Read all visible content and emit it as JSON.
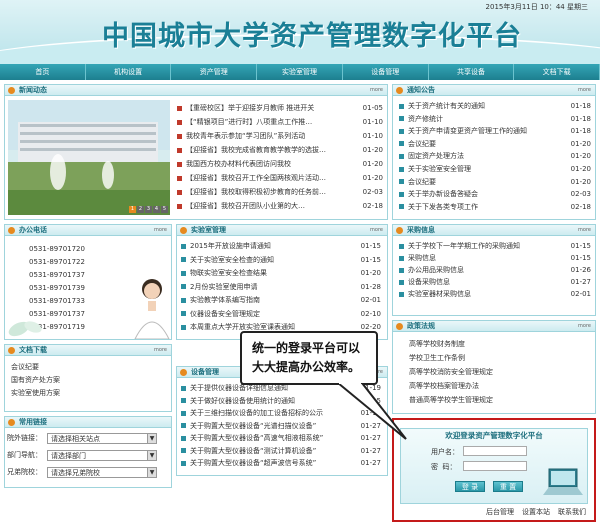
{
  "header": {
    "title": "中国城市大学资产管理数字化平台",
    "date": "2015年3月11日 10：44 星期三"
  },
  "nav": [
    "首页",
    "机构设置",
    "资产管理",
    "实验室管理",
    "设备管理",
    "共享设备",
    "文档下载"
  ],
  "news": {
    "title": "新闻动态",
    "more": "more",
    "items": [
      {
        "text": "【重磅校区】举于迎接岁月教师 推进开关",
        "date": "01-05"
      },
      {
        "text": "【“精银项目”进行时】八项重点工作推…",
        "date": "01-10"
      },
      {
        "text": "我校青年表示参加“学习团队”系列活动",
        "date": "01-10"
      },
      {
        "text": "【迎接省】我校完成省教育教学教学的选拔…",
        "date": "01-20"
      },
      {
        "text": "我国西方校办材料代表团访问我校",
        "date": "01-20"
      },
      {
        "text": "【迎接省】我校召开工作全国两核观片活动…",
        "date": "01-20"
      },
      {
        "text": "【迎接省】我校取得积极初步教育的任务前…",
        "date": "02-03"
      },
      {
        "text": "【迎接省】我校召开团队小业第的大…",
        "date": "02-18"
      }
    ],
    "slider": [
      "1",
      "2",
      "3",
      "4",
      "5"
    ]
  },
  "notice": {
    "title": "通知公告",
    "more": "more",
    "items": [
      {
        "text": "关于资产统计有关的通知",
        "date": "01-18"
      },
      {
        "text": "资产修统计",
        "date": "01-18"
      },
      {
        "text": "关于资产申请变更资产管理工作的通知",
        "date": "01-18"
      },
      {
        "text": "会议纪要",
        "date": "01-20"
      },
      {
        "text": "固定资产处理方法",
        "date": "01-20"
      },
      {
        "text": "关于实验室安全管理",
        "date": "01-20"
      },
      {
        "text": "会议纪要",
        "date": "01-20"
      },
      {
        "text": "关于举办新设备答疑会",
        "date": "02-03"
      },
      {
        "text": "关于下发各类专项工作",
        "date": "02-18"
      }
    ]
  },
  "office": {
    "title": "办公电话",
    "more": "more",
    "phones": [
      "0531-89701720",
      "0531-89701722",
      "0531-89701737",
      "0531-89701739",
      "0531-89701733",
      "0531-89701737",
      "0531-89701719"
    ]
  },
  "lab": {
    "title": "实验室管理",
    "more": "more",
    "items": [
      {
        "text": "2015年开放设施申请通知",
        "date": "01-15"
      },
      {
        "text": "关于实验室安全检查的通知",
        "date": "01-15"
      },
      {
        "text": "物联实验室安全检查结果",
        "date": "01-20"
      },
      {
        "text": "2月份实验室使用申请",
        "date": "01-28"
      },
      {
        "text": "实验教学体系编写指南",
        "date": "02-01"
      },
      {
        "text": "仪器设备安全管理规定",
        "date": "02-10"
      },
      {
        "text": "本周重点大学开放实验室课表通知",
        "date": "02-20"
      }
    ]
  },
  "purchase": {
    "title": "采购信息",
    "more": "more",
    "items": [
      {
        "text": "关于学校下一年学期工作的采购通知",
        "date": "01-15"
      },
      {
        "text": "采购信息",
        "date": "01-15"
      },
      {
        "text": "办公用品采购信息",
        "date": "01-26"
      },
      {
        "text": "设备采购信息",
        "date": "01-27"
      },
      {
        "text": "实验室器材采购信息",
        "date": "02-01"
      }
    ]
  },
  "docs": {
    "title": "文档下载",
    "more": "more",
    "items": [
      "会议纪要",
      "国有资产处方案",
      "实验室使用方案"
    ]
  },
  "equipment": {
    "title": "设备管理",
    "more": "more",
    "items": [
      {
        "text": "关于提供仪器设备详细信息通知",
        "date": "01-19"
      },
      {
        "text": "关于做好仪器设备使用统计的通知",
        "date": "01-15"
      },
      {
        "text": "关于三维扫描仪设备的加工设备招标的公示",
        "date": "01-19"
      },
      {
        "text": "关于购置大型仪器设备“光谱扫描仪设备”",
        "date": "01-27"
      },
      {
        "text": "关于购置大型仪器设备“高速气相液相系统”",
        "date": "01-27"
      },
      {
        "text": "关于购置大型仪器设备“测试计算机设备”",
        "date": "01-27"
      },
      {
        "text": "关于购置大型仪器设备“超声波信号系统”",
        "date": "01-27"
      }
    ]
  },
  "policy": {
    "title": "政策法规",
    "more": "more",
    "items": [
      "高等学校财务制度",
      "学校卫生工作条例",
      "高等学校消防安全管理规定",
      "高等学校档案管理办法",
      "普通高等学校学生管理规定"
    ]
  },
  "links": {
    "title": "常用链接",
    "rows": [
      {
        "label": "院外链接：",
        "value": "请选择相关站点"
      },
      {
        "label": "部门导航：",
        "value": "请选择部门"
      },
      {
        "label": "兄弟院校：",
        "value": "请选择兄弟院校"
      }
    ]
  },
  "login": {
    "title": "欢迎登录资产管理数字化平台",
    "user_label": "用户名：",
    "pass_label": "密  码：",
    "submit": "登 录",
    "reset": "重 置",
    "footer": [
      "后台管理",
      "设置本站",
      "联系我们"
    ]
  },
  "callout": {
    "text": "统一的登录平台可以大大提高办公效率。"
  },
  "colors": {
    "accent": "#1d7f8f",
    "highlight_border": "#c41a1a"
  }
}
